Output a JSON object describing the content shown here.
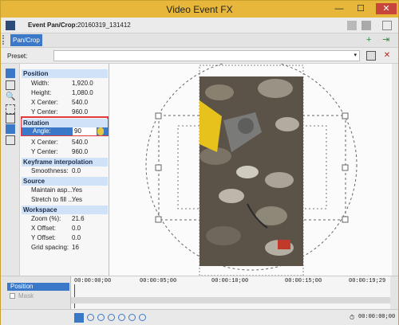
{
  "window": {
    "title": "Video Event FX",
    "minimize": "—",
    "maximize": "☐",
    "close": "✕"
  },
  "event": {
    "label": "Event Pan/Crop:",
    "value": "20160319_131412"
  },
  "tab": {
    "label": "Pan/Crop"
  },
  "preset": {
    "label": "Preset:",
    "value": ""
  },
  "sections": {
    "position": "Position",
    "rotation": "Rotation",
    "keyframe": "Keyframe interpolation",
    "source": "Source",
    "workspace": "Workspace"
  },
  "position": {
    "width": {
      "label": "Width:",
      "value": "1,920.0"
    },
    "height": {
      "label": "Height:",
      "value": "1,080.0"
    },
    "x_center": {
      "label": "X Center:",
      "value": "540.0"
    },
    "y_center": {
      "label": "Y Center:",
      "value": "960.0"
    }
  },
  "rotation": {
    "angle": {
      "label": "Angle:",
      "value": "90"
    },
    "x_center": {
      "label": "X Center:",
      "value": "540.0"
    },
    "y_center": {
      "label": "Y Center:",
      "value": "960.0"
    }
  },
  "keyframe": {
    "smoothness": {
      "label": "Smoothness:",
      "value": "0.0"
    }
  },
  "source": {
    "maintain": {
      "label": "Maintain asp...",
      "value": "Yes"
    },
    "stretch": {
      "label": "Stretch to fill ...",
      "value": "Yes"
    }
  },
  "workspace": {
    "zoom": {
      "label": "Zoom (%):",
      "value": "21.6"
    },
    "x_offset": {
      "label": "X Offset:",
      "value": "0.0"
    },
    "y_offset": {
      "label": "Y Offset:",
      "value": "0.0"
    },
    "grid": {
      "label": "Grid spacing:",
      "value": "16"
    }
  },
  "timeline": {
    "tracks": [
      "Position",
      "Mask"
    ],
    "time_start": "00:00:00;00",
    "ticks": [
      "00:00:00;00",
      "00:00:05;00",
      "00:00:10;00",
      "00:00:15;00",
      "00:00:19;29"
    ],
    "time_end": "00:00:00;00"
  },
  "colors": {
    "accent": "#e6b73a",
    "section": "#cfe2f7",
    "selected": "#3c78c8",
    "highlight": "#e23a3a"
  }
}
